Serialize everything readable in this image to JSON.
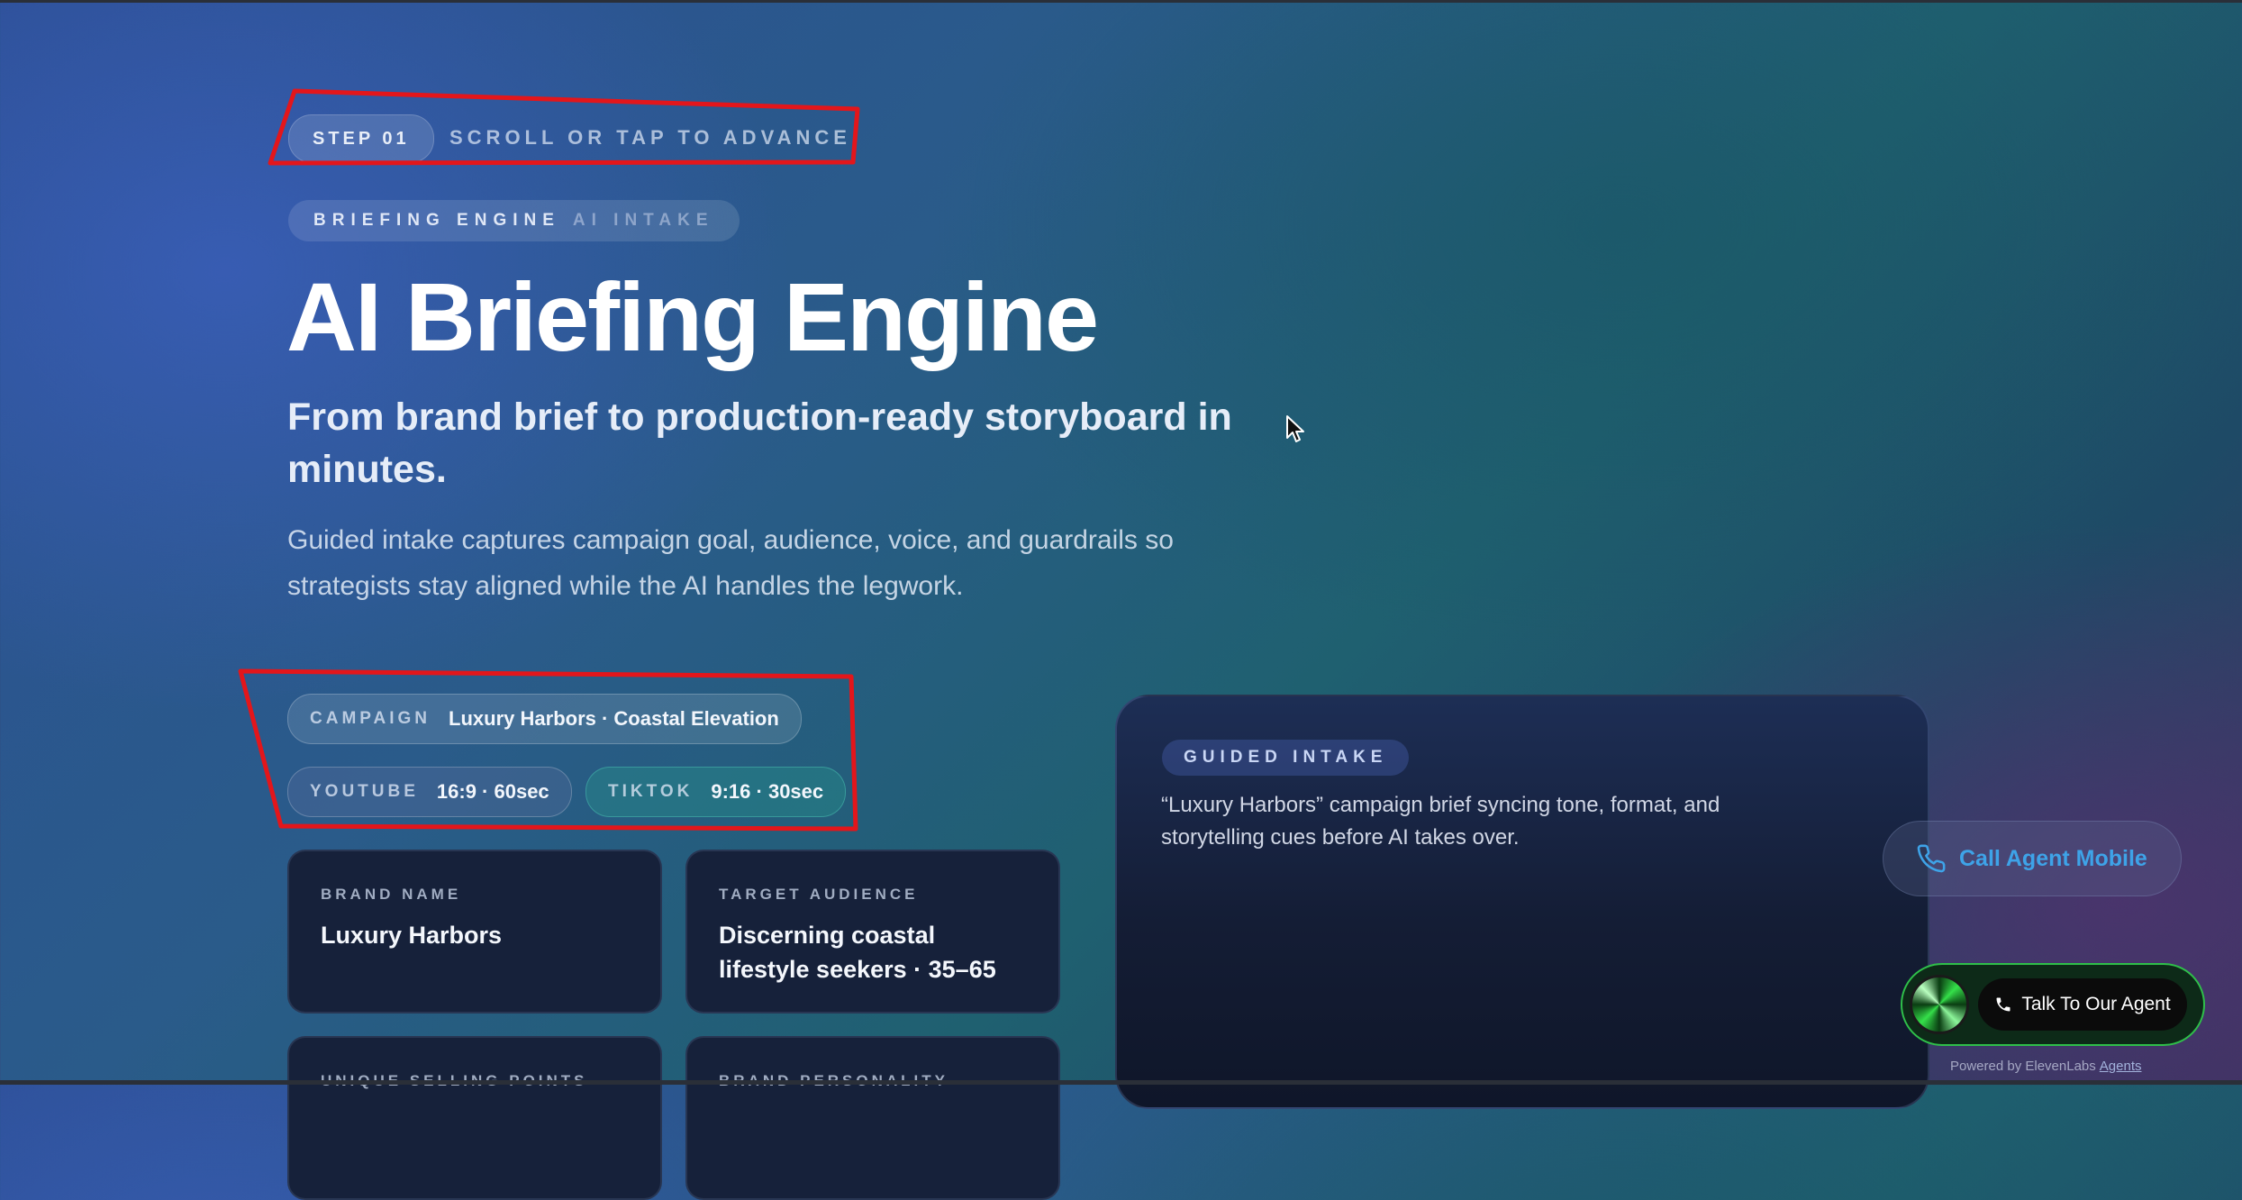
{
  "step": {
    "label": "STEP 01",
    "hint": "SCROLL OR TAP TO ADVANCE"
  },
  "engine_pill": {
    "primary": "BRIEFING ENGINE",
    "secondary": "AI INTAKE"
  },
  "hero": {
    "title": "AI Briefing Engine",
    "subtitle": "From brand brief to production-ready storyboard in minutes.",
    "description": "Guided intake captures campaign goal, audience, voice, and guardrails so strategists stay aligned while the AI handles the legwork."
  },
  "chips": {
    "campaign": {
      "key": "CAMPAIGN",
      "value": "Luxury Harbors · Coastal Elevation"
    },
    "youtube": {
      "key": "YOUTUBE",
      "value": "16:9 · 60sec"
    },
    "tiktok": {
      "key": "TIKTOK",
      "value": "9:16 · 30sec"
    }
  },
  "cards": [
    {
      "label": "BRAND NAME",
      "value": "Luxury Harbors"
    },
    {
      "label": "TARGET AUDIENCE",
      "value": "Discerning coastal lifestyle seekers · 35–65"
    },
    {
      "label": "UNIQUE SELLING POINTS",
      "value": ""
    },
    {
      "label": "BRAND PERSONALITY",
      "value": ""
    }
  ],
  "intake": {
    "pill": "GUIDED INTAKE",
    "text": "“Luxury Harbors” campaign brief syncing tone, format, and storytelling cues before AI takes over."
  },
  "call_agent": {
    "label": "Call Agent Mobile",
    "icon": "phone-icon"
  },
  "agent_widget": {
    "button_label": "Talk To Our Agent",
    "powered_by": "Powered by ElevenLabs",
    "powered_link": "Agents"
  },
  "colors": {
    "accent_blue": "#3ea3e8",
    "annotation_red": "#e3161b",
    "widget_green": "#2fbf4a"
  }
}
